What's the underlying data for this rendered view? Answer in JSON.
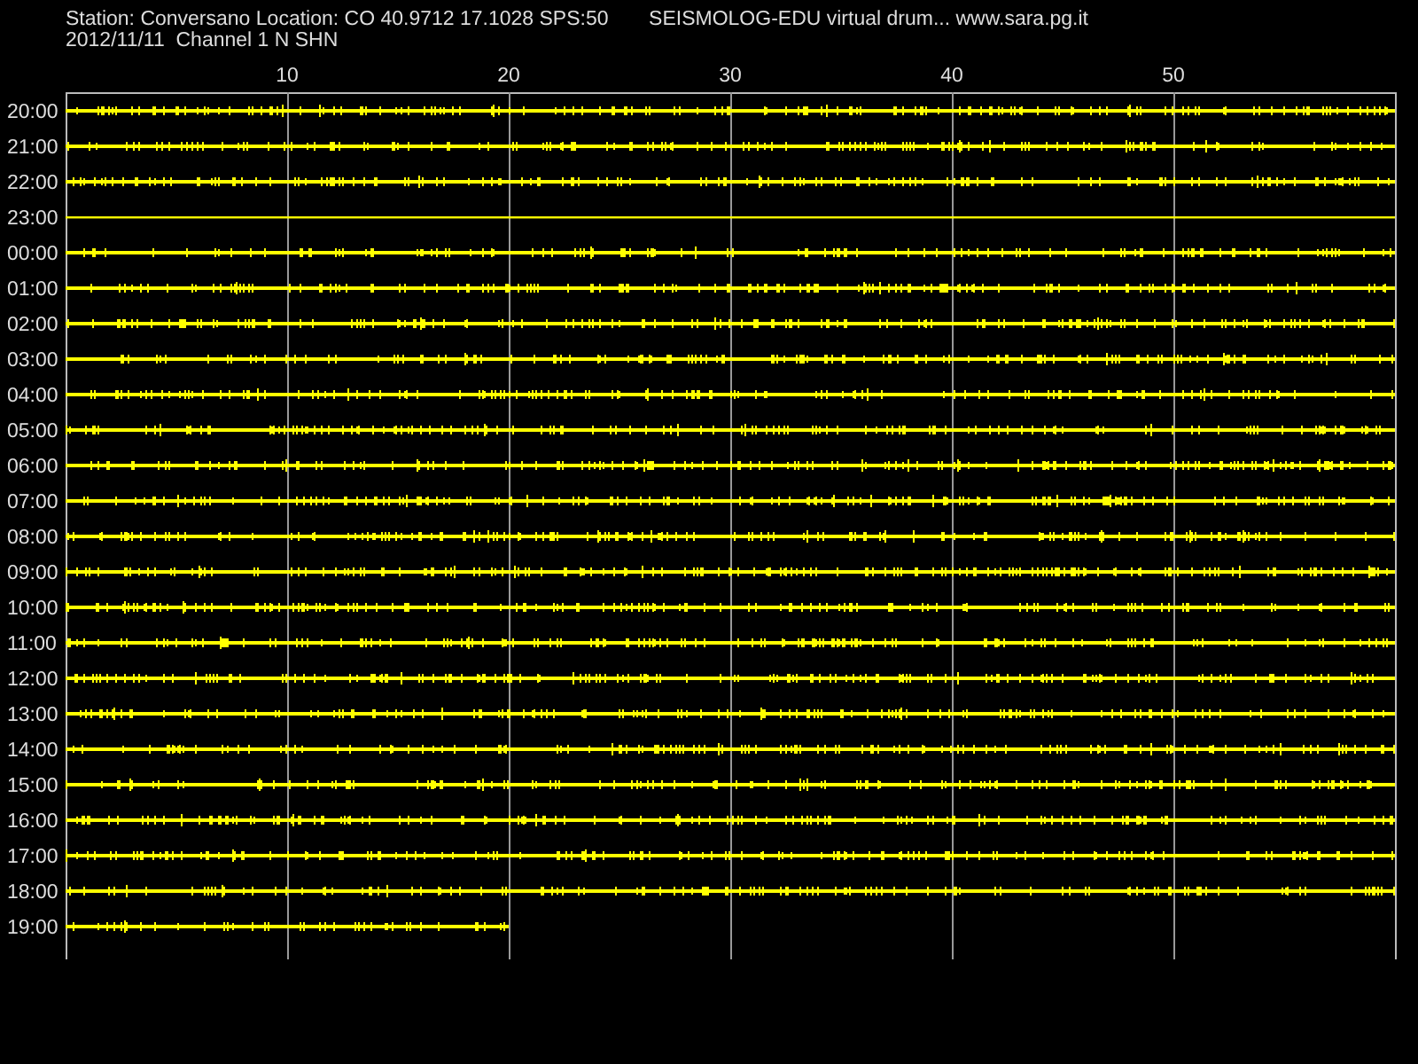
{
  "header": {
    "station": "Station: Conversano Location: CO 40.9712 17.1028 SPS:50",
    "title": "SEISMOLOG-EDU virtual drum... www.sara.pg.it",
    "date_channel": "2012/11/11  Channel 1 N SHN"
  },
  "minute_ticks": [
    "10",
    "20",
    "30",
    "40",
    "50"
  ],
  "rows": [
    {
      "label": "20:00",
      "kind": "noisy",
      "level": 1
    },
    {
      "label": "21:00",
      "kind": "noisy",
      "level": 1
    },
    {
      "label": "22:00",
      "kind": "noisy",
      "level": 1
    },
    {
      "label": "23:00",
      "kind": "flat",
      "level": 1
    },
    {
      "label": "00:00",
      "kind": "noisy",
      "level": 1
    },
    {
      "label": "01:00",
      "kind": "noisy",
      "level": 1
    },
    {
      "label": "02:00",
      "kind": "noisy",
      "level": 1
    },
    {
      "label": "03:00",
      "kind": "noisy",
      "level": 1
    },
    {
      "label": "04:00",
      "kind": "noisy",
      "level": 1
    },
    {
      "label": "05:00",
      "kind": "noisy",
      "level": 1
    },
    {
      "label": "06:00",
      "kind": "noisy",
      "level": 1
    },
    {
      "label": "07:00",
      "kind": "noisy",
      "level": 1
    },
    {
      "label": "08:00",
      "kind": "noisy",
      "level": 1
    },
    {
      "label": "09:00",
      "kind": "noisy",
      "level": 1
    },
    {
      "label": "10:00",
      "kind": "noisy",
      "level": 1
    },
    {
      "label": "11:00",
      "kind": "noisy",
      "level": 1
    },
    {
      "label": "12:00",
      "kind": "noisy",
      "level": 1
    },
    {
      "label": "13:00",
      "kind": "noisy",
      "level": 1
    },
    {
      "label": "14:00",
      "kind": "noisy",
      "level": 1
    },
    {
      "label": "15:00",
      "kind": "noisy",
      "level": 1
    },
    {
      "label": "16:00",
      "kind": "noisy",
      "level": 1
    },
    {
      "label": "17:00",
      "kind": "noisy",
      "level": 1
    },
    {
      "label": "18:00",
      "kind": "noisy",
      "level": 1
    },
    {
      "label": "19:00",
      "kind": "noisy",
      "level": 0.3333
    }
  ]
}
